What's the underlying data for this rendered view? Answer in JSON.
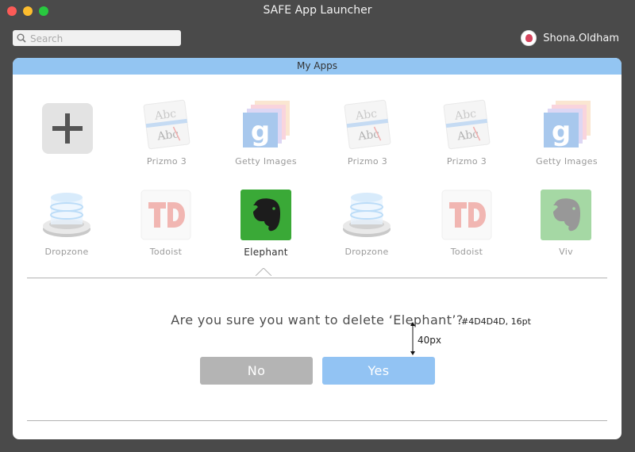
{
  "window": {
    "title": "SAFE App Launcher"
  },
  "search": {
    "placeholder": "Search",
    "value": ""
  },
  "user": {
    "name": "Shona.Oldham"
  },
  "panel": {
    "title": "My Apps"
  },
  "apps_row1": [
    {
      "label": "",
      "icon": "add-icon"
    },
    {
      "label": "Prizmo 3",
      "icon": "prizmo-icon"
    },
    {
      "label": "Getty Images",
      "icon": "getty-images-icon"
    },
    {
      "label": "Prizmo 3",
      "icon": "prizmo-icon"
    },
    {
      "label": "Prizmo 3",
      "icon": "prizmo-icon"
    },
    {
      "label": "Getty Images",
      "icon": "getty-images-icon"
    }
  ],
  "apps_row2": [
    {
      "label": "Dropzone",
      "icon": "dropzone-icon"
    },
    {
      "label": "Todoist",
      "icon": "todoist-icon"
    },
    {
      "label": "Elephant",
      "icon": "evernote-elephant-icon",
      "selected": true
    },
    {
      "label": "Dropzone",
      "icon": "dropzone-icon"
    },
    {
      "label": "Todoist",
      "icon": "todoist-icon"
    },
    {
      "label": "Viv",
      "icon": "evernote-elephant-icon"
    }
  ],
  "dialog": {
    "question": "Are you sure you want to delete ‘Elephant’?",
    "spec_note": "#4D4D4D, 16pt",
    "spacing_note": "40px",
    "no_label": "No",
    "yes_label": "Yes"
  },
  "colors": {
    "header": "#93c5f2",
    "yes_button": "#92c3f3",
    "no_button": "#b4b4b4",
    "question_text": "#4D4D4D"
  }
}
